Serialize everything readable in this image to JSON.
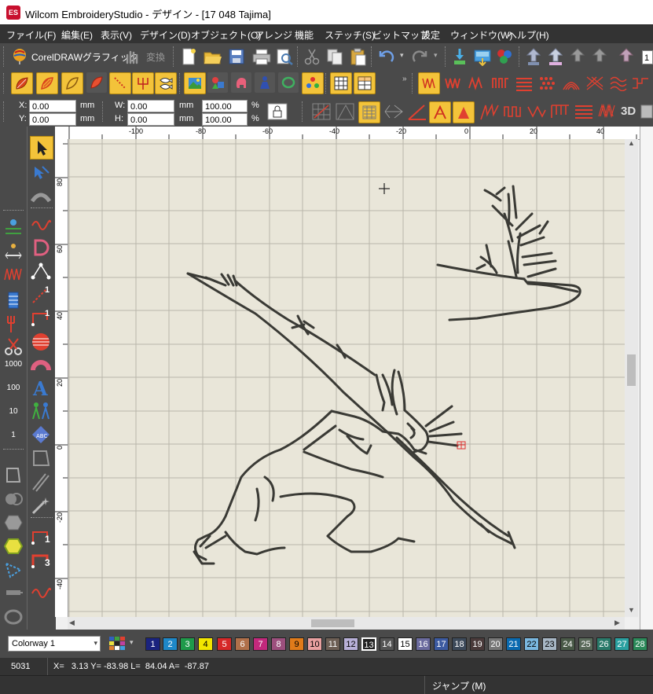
{
  "app": {
    "title": "Wilcom EmbroideryStudio - デザイン - [17 048        Tajima]",
    "logo_text": "ES"
  },
  "menu": [
    "ファイル(F)",
    "編集(E)",
    "表示(V)",
    "デザイン(D)",
    "オブジェクト(O)",
    "アレンジ",
    "機能",
    "ステッチ(S)",
    "ビットマップ",
    "設定",
    "ウィンドウ(W)",
    "ヘルプ(H)"
  ],
  "toolbar": {
    "coreldraw_label": "CorelDRAWグラフィック",
    "convert_label": "変換",
    "zoom_value": "1"
  },
  "coords": {
    "x_label": "X:",
    "x_value": "0.00",
    "x_unit": "mm",
    "y_label": "Y:",
    "y_value": "0.00",
    "y_unit": "mm",
    "w_label": "W:",
    "w_value": "0.00",
    "w_unit": "mm",
    "h_label": "H:",
    "h_value": "0.00",
    "h_unit": "mm",
    "wpct_value": "100.00",
    "wpct_unit": "%",
    "hpct_value": "100.00",
    "hpct_unit": "%"
  },
  "stitch_count_labels": [
    "1000",
    "100",
    "10",
    "1"
  ],
  "left_tool_labels": {
    "one": "1",
    "three": "3"
  },
  "icons": {
    "threeD": "3D"
  },
  "ruler": {
    "h_ticks": [
      "-100",
      "-80",
      "-60",
      "-40",
      "-20",
      "0",
      "20",
      "40"
    ],
    "v_ticks": [
      "80",
      "60",
      "40",
      "20",
      "0",
      "-20",
      "-40"
    ]
  },
  "colorway": {
    "selected": "Colorway 1",
    "colors": [
      {
        "n": "1",
        "c": "#1a237e",
        "t": "#fff"
      },
      {
        "n": "2",
        "c": "#1e88c8",
        "t": "#fff"
      },
      {
        "n": "3",
        "c": "#1f9a4a",
        "t": "#fff"
      },
      {
        "n": "4",
        "c": "#f2e600",
        "t": "#000"
      },
      {
        "n": "5",
        "c": "#d62828",
        "t": "#fff"
      },
      {
        "n": "6",
        "c": "#b0704a",
        "t": "#fff"
      },
      {
        "n": "7",
        "c": "#c2297c",
        "t": "#fff"
      },
      {
        "n": "8",
        "c": "#9c4f7d",
        "t": "#fff"
      },
      {
        "n": "9",
        "c": "#e07b1a",
        "t": "#000"
      },
      {
        "n": "10",
        "c": "#e8a0a0",
        "t": "#000"
      },
      {
        "n": "11",
        "c": "#6d5f55",
        "t": "#fff"
      },
      {
        "n": "12",
        "c": "#b8b0d8",
        "t": "#000"
      },
      {
        "n": "13",
        "c": "#222222",
        "t": "#fff"
      },
      {
        "n": "14",
        "c": "#555555",
        "t": "#fff"
      },
      {
        "n": "15",
        "c": "#ffffff",
        "t": "#000"
      },
      {
        "n": "16",
        "c": "#6b6b9e",
        "t": "#fff"
      },
      {
        "n": "17",
        "c": "#3c5aa0",
        "t": "#fff"
      },
      {
        "n": "18",
        "c": "#3d4a5a",
        "t": "#fff"
      },
      {
        "n": "19",
        "c": "#4a3a3a",
        "t": "#fff"
      },
      {
        "n": "20",
        "c": "#777777",
        "t": "#fff"
      },
      {
        "n": "21",
        "c": "#0a6ab0",
        "t": "#fff"
      },
      {
        "n": "22",
        "c": "#7ab8e0",
        "t": "#000"
      },
      {
        "n": "23",
        "c": "#a7b6c4",
        "t": "#000"
      },
      {
        "n": "24",
        "c": "#4a5a48",
        "t": "#fff"
      },
      {
        "n": "25",
        "c": "#5a6a5a",
        "t": "#fff"
      },
      {
        "n": "26",
        "c": "#2a7a6a",
        "t": "#fff"
      },
      {
        "n": "27",
        "c": "#2aa0a0",
        "t": "#fff"
      },
      {
        "n": "28",
        "c": "#2c8a5a",
        "t": "#fff"
      }
    ]
  },
  "status": {
    "stitch_count": "5031",
    "position": "X=   3.13 Y= -83.98 L=  84.04 A=  -87.87",
    "mode": "ジャンプ (M)"
  },
  "colors": {
    "accent": "#f3c33a",
    "toolbar_bg": "#4a4a4a",
    "canvas_bg": "#e9e6d9",
    "thread": "#3a3a35"
  }
}
